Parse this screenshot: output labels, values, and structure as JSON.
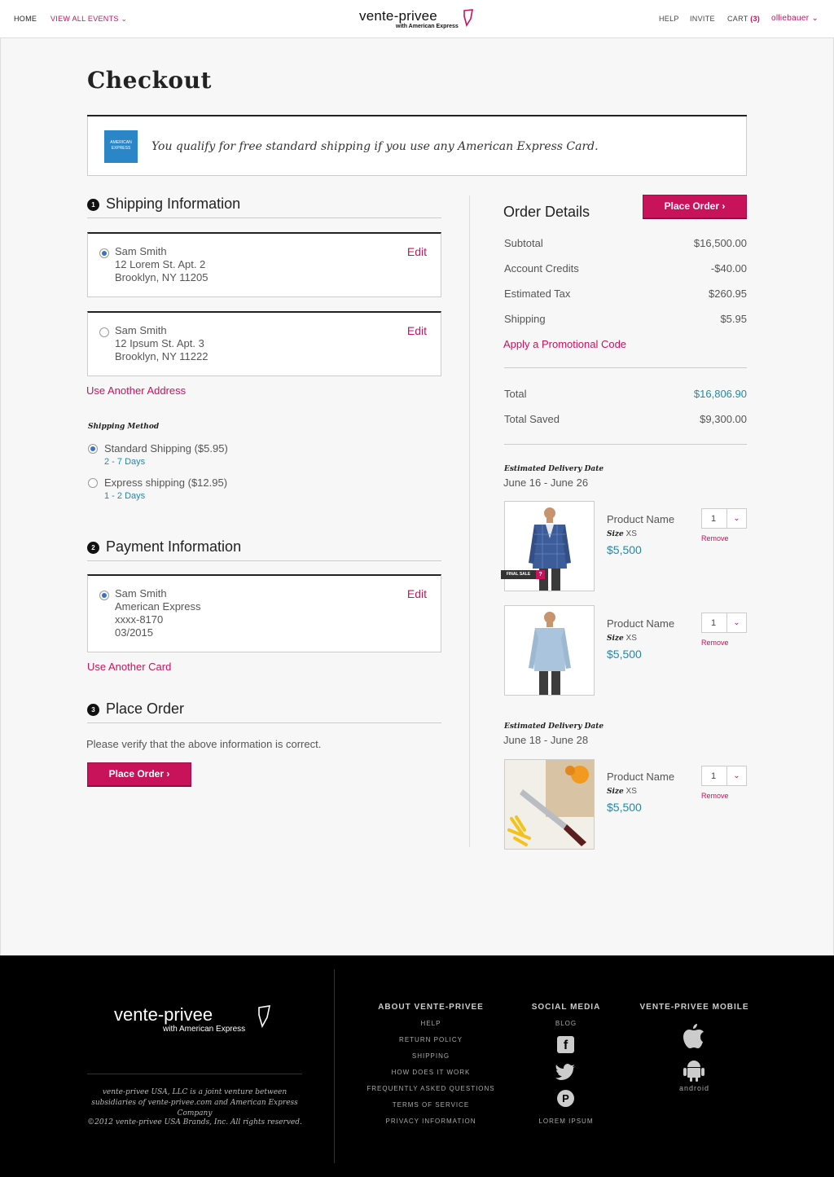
{
  "header": {
    "home": "HOME",
    "view_all_events": "VIEW ALL EVENTS",
    "logo_main": "vente-privee",
    "logo_sub": "with American Express",
    "help": "HELP",
    "invite": "INVITE",
    "cart_label": "CART",
    "cart_count": "(3)",
    "username": "olliebauer"
  },
  "page": {
    "title": "Checkout",
    "promo_text": "You qualify for free standard shipping if you use any American Express Card.",
    "amex_logo_text": "AMERICAN EXPRESS"
  },
  "shipping": {
    "step_num": "1",
    "heading": "Shipping Information",
    "addresses": [
      {
        "selected": true,
        "name": "Sam Smith",
        "line1": "12 Lorem St. Apt. 2",
        "line2": "Brooklyn, NY 11205",
        "edit": "Edit"
      },
      {
        "selected": false,
        "name": "Sam Smith",
        "line1": "12 Ipsum St. Apt. 3",
        "line2": "Brooklyn, NY 11222",
        "edit": "Edit"
      }
    ],
    "use_another": "Use Another Address",
    "method_label": "Shipping Method",
    "methods": [
      {
        "selected": true,
        "name": "Standard Shipping ($5.95)",
        "days": "2 - 7 Days"
      },
      {
        "selected": false,
        "name": "Express shipping ($12.95)",
        "days": "1 - 2 Days"
      }
    ]
  },
  "payment": {
    "step_num": "2",
    "heading": "Payment Information",
    "card": {
      "name": "Sam Smith",
      "type": "American Express",
      "number": "xxxx-8170",
      "expiry": "03/2015",
      "edit": "Edit"
    },
    "use_another": "Use Another Card"
  },
  "place_order": {
    "step_num": "3",
    "heading": "Place Order",
    "verify_text": "Please verify that the above information is correct.",
    "button": "Place Order ›"
  },
  "order_details": {
    "heading": "Order Details",
    "button": "Place Order ›",
    "rows": [
      {
        "label": "Subtotal",
        "value": "$16,500.00"
      },
      {
        "label": "Account Credits",
        "value": "-$40.00"
      },
      {
        "label": "Estimated Tax",
        "value": "$260.95"
      },
      {
        "label": "Shipping",
        "value": "$5.95"
      }
    ],
    "promo_link": "Apply a Promotional Code",
    "total_label": "Total",
    "total_value": "$16,806.90",
    "saved_label": "Total Saved",
    "saved_value": "$9,300.00",
    "delivery_groups": [
      {
        "label": "Estimated Delivery Date",
        "dates": "June 16 - June 26",
        "items": [
          {
            "name": "Product Name",
            "size_label": "Size",
            "size": "XS",
            "price": "$5,500",
            "qty": "1",
            "remove": "Remove",
            "badge": "FINAL SALE",
            "badge_q": "?"
          },
          {
            "name": "Product Name",
            "size_label": "Size",
            "size": "XS",
            "price": "$5,500",
            "qty": "1",
            "remove": "Remove"
          }
        ]
      },
      {
        "label": "Estimated Delivery Date",
        "dates": "June 18 - June 28",
        "items": [
          {
            "name": "Product Name",
            "size_label": "Size",
            "size": "XS",
            "price": "$5,500",
            "qty": "1",
            "remove": "Remove"
          }
        ]
      }
    ]
  },
  "footer": {
    "logo_main": "vente-privee",
    "logo_sub": "with American Express",
    "legal": "vente-privee USA, LLC is a joint venture between subsidiaries of vente-privee.com and American Express Company",
    "copyright": "©2012 vente-privee USA Brands, Inc. All rights reserved.",
    "about_title": "ABOUT VENTE-PRIVEE",
    "about_links": [
      "HELP",
      "RETURN POLICY",
      "SHIPPING",
      "HOW DOES IT WORK",
      "FREQUENTLY ASKED QUESTIONS",
      "TERMS OF SERVICE",
      "PRIVACY INFORMATION"
    ],
    "social_title": "SOCIAL MEDIA",
    "social_blog": "BLOG",
    "social_lorem": "LOREM IPSUM",
    "mobile_title": "VENTE-PRIVEE MOBILE",
    "android_label": "android"
  },
  "colors": {
    "accent": "#c8135a",
    "teal": "#1f8aa8",
    "amex_blue": "#2a86c7"
  }
}
